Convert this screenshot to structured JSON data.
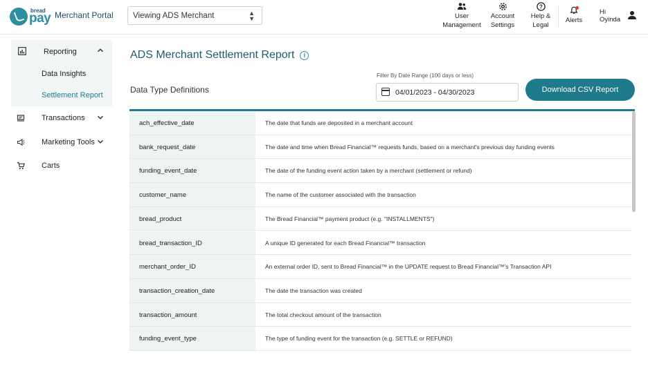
{
  "header": {
    "logo_small": "bread",
    "logo_big": "pay",
    "portal_title": "Merchant Portal",
    "viewing": "Viewing ADS Merchant",
    "nav": [
      {
        "line1": "User",
        "line2": "Management",
        "icon": "users-icon"
      },
      {
        "line1": "Account",
        "line2": "Settings",
        "icon": "gear-icon"
      },
      {
        "line1": "Help &",
        "line2": "Legal",
        "icon": "help-icon"
      },
      {
        "line1": "Alerts",
        "line2": "",
        "icon": "bell-icon"
      }
    ],
    "greeting": "Hi",
    "user_name": "Oyinda"
  },
  "sidebar": {
    "reporting": "Reporting",
    "data_insights": "Data Insights",
    "settlement_report": "Settlement Report",
    "transactions": "Transactions",
    "marketing_tools": "Marketing Tools",
    "carts": "Carts"
  },
  "page": {
    "title": "ADS Merchant Settlement Report",
    "subtitle": "Data Type Definitions",
    "filter_label": "Filter By Date Range (100 days or less)",
    "date_range": "04/01/2023 - 04/30/2023",
    "download": "Download CSV Report"
  },
  "rows": [
    {
      "k": "ach_effective_date",
      "v": "The date that funds are deposited in a merchant account"
    },
    {
      "k": "bank_request_date",
      "v": "The date and time when Bread Financial™ requests funds, based on a merchant's previous day funding events"
    },
    {
      "k": "funding_event_date",
      "v": "The date of the funding event action taken by a merchant (settlement or refund)"
    },
    {
      "k": "customer_name",
      "v": "The name of the customer associated with the transaction"
    },
    {
      "k": "bread_product",
      "v": "The Bread Financial™ payment product (e.g. \"INSTALLMENTS\")"
    },
    {
      "k": "bread_transaction_ID",
      "v": "A unique ID generated for each Bread Financial™ transaction"
    },
    {
      "k": "merchant_order_ID",
      "v": "An external order ID, sent to Bread Financial™ in the UPDATE request to Bread Financial™'s Transaction API"
    },
    {
      "k": "transaction_creation_date",
      "v": "The date the transaction was created"
    },
    {
      "k": "transaction_amount",
      "v": "The total checkout amount of the transaction"
    },
    {
      "k": "funding_event_type",
      "v": "The type of funding event for the transaction (e.g. SETTLE or REFUND)"
    }
  ]
}
